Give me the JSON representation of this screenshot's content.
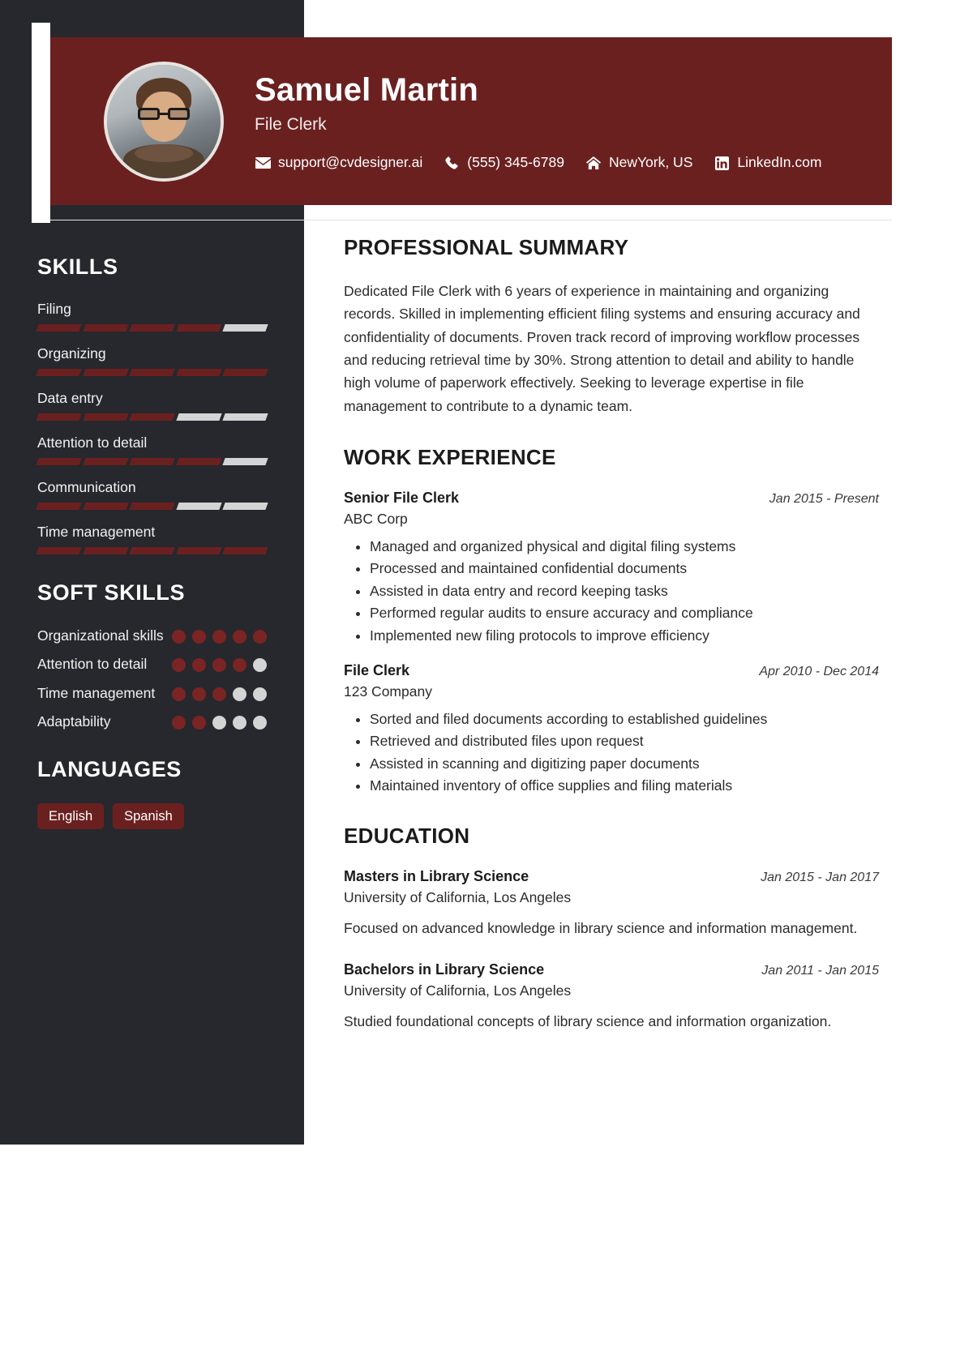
{
  "header": {
    "name": "Samuel Martin",
    "role": "File Clerk",
    "avatar_alt": "profile-photo",
    "contacts": [
      {
        "icon": "envelope-icon",
        "text": "support@cvdesigner.ai"
      },
      {
        "icon": "phone-icon",
        "text": "(555) 345-6789"
      },
      {
        "icon": "home-icon",
        "text": "NewYork, US"
      },
      {
        "icon": "linkedin-icon",
        "text": "LinkedIn.com"
      }
    ]
  },
  "colors": {
    "accent": "#6b2020",
    "sidebar_bg": "#26282d",
    "bar_empty": "#d4d4d4",
    "dot_filled": "#7a2424",
    "dot_empty": "#d4d4d4"
  },
  "sidebar": {
    "skills_heading": "SKILLS",
    "skills": [
      {
        "label": "Filing",
        "level": 4,
        "max": 5
      },
      {
        "label": "Organizing",
        "level": 5,
        "max": 5
      },
      {
        "label": "Data entry",
        "level": 3,
        "max": 5
      },
      {
        "label": "Attention to detail",
        "level": 4,
        "max": 5
      },
      {
        "label": "Communication",
        "level": 3,
        "max": 5
      },
      {
        "label": "Time management",
        "level": 5,
        "max": 5
      }
    ],
    "soft_skills_heading": "SOFT SKILLS",
    "soft_skills": [
      {
        "label": "Organizational skills",
        "level": 5,
        "max": 5
      },
      {
        "label": "Attention to detail",
        "level": 4,
        "max": 5
      },
      {
        "label": "Time management",
        "level": 3,
        "max": 5
      },
      {
        "label": "Adaptability",
        "level": 2,
        "max": 5
      }
    ],
    "languages_heading": "LANGUAGES",
    "languages": [
      "English",
      "Spanish"
    ]
  },
  "main": {
    "summary_heading": "PROFESSIONAL SUMMARY",
    "summary_text": "Dedicated File Clerk with 6 years of experience in maintaining and organizing records. Skilled in implementing efficient filing systems and ensuring accuracy and confidentiality of documents. Proven track record of improving workflow processes and reducing retrieval time by 30%. Strong attention to detail and ability to handle high volume of paperwork effectively. Seeking to leverage expertise in file management to contribute to a dynamic team.",
    "work_heading": "WORK EXPERIENCE",
    "work": [
      {
        "title": "Senior File Clerk",
        "date": "Jan 2015 - Present",
        "company": "ABC Corp",
        "bullets": [
          "Managed and organized physical and digital filing systems",
          "Processed and maintained confidential documents",
          "Assisted in data entry and record keeping tasks",
          "Performed regular audits to ensure accuracy and compliance",
          "Implemented new filing protocols to improve efficiency"
        ]
      },
      {
        "title": "File Clerk",
        "date": "Apr 2010 - Dec 2014",
        "company": "123 Company",
        "bullets": [
          "Sorted and filed documents according to established guidelines",
          "Retrieved and distributed files upon request",
          "Assisted in scanning and digitizing paper documents",
          "Maintained inventory of office supplies and filing materials"
        ]
      }
    ],
    "education_heading": "EDUCATION",
    "education": [
      {
        "degree": "Masters in Library Science",
        "date": "Jan 2015 - Jan 2017",
        "school": "University of California, Los Angeles",
        "description": "Focused on advanced knowledge in library science and information management."
      },
      {
        "degree": "Bachelors in Library Science",
        "date": "Jan 2011 - Jan 2015",
        "school": "University of California, Los Angeles",
        "description": "Studied foundational concepts of library science and information organization."
      }
    ]
  }
}
